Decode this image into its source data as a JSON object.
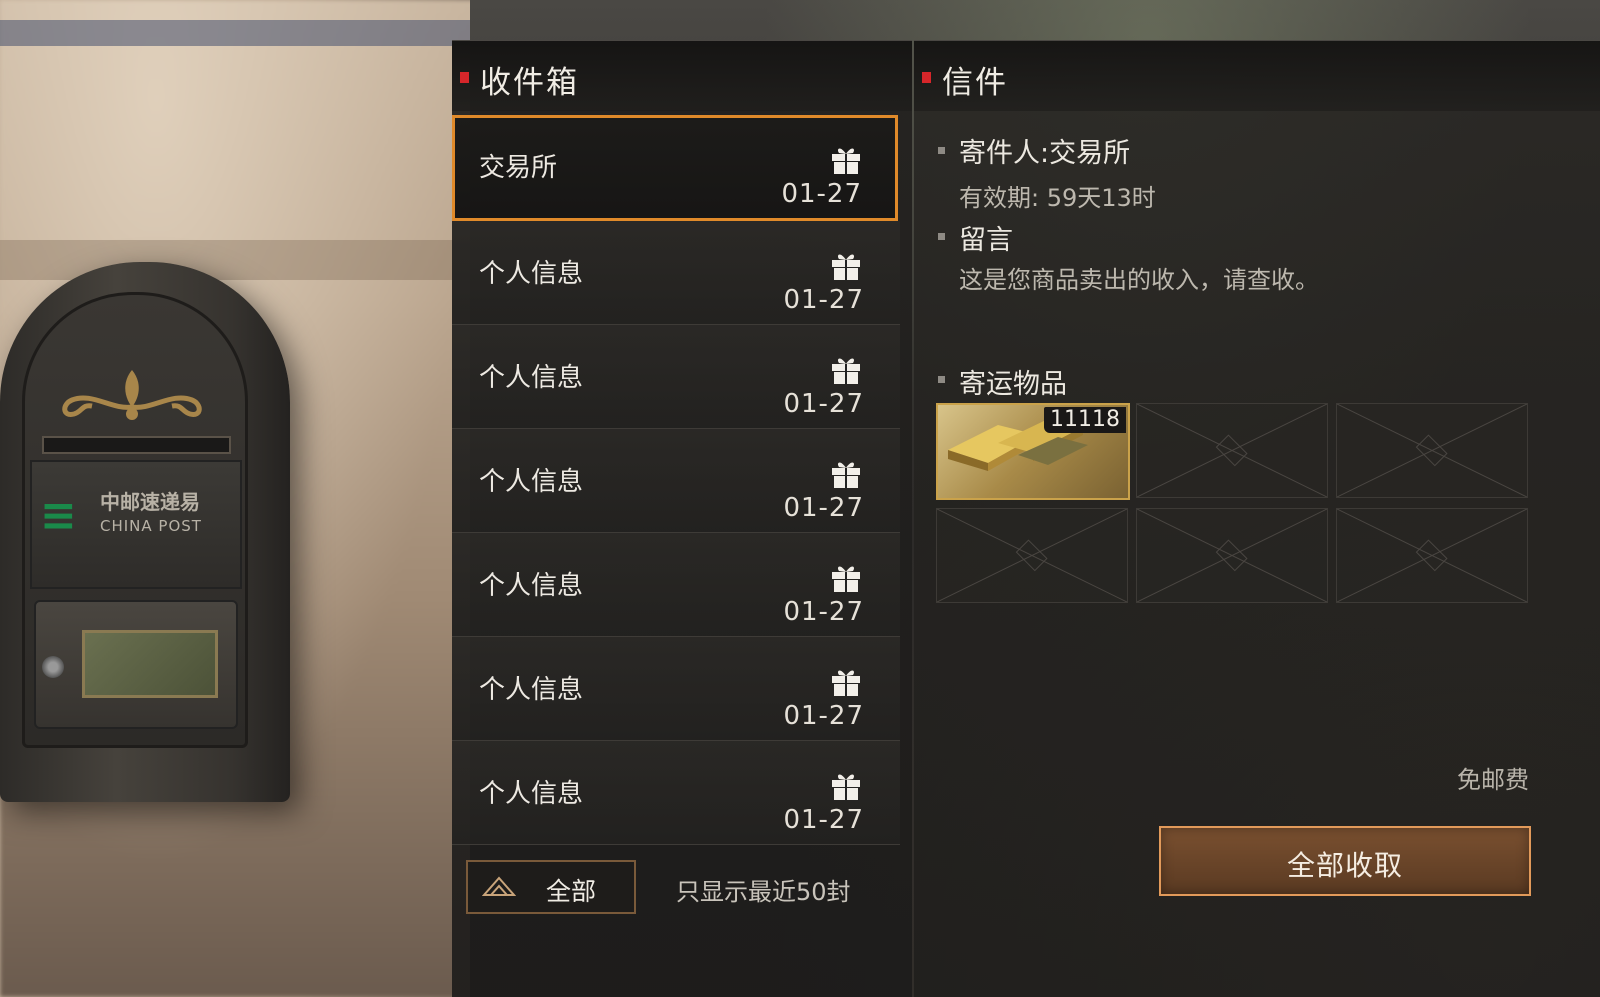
{
  "inbox": {
    "title": "收件箱",
    "items": [
      {
        "sender": "交易所",
        "date": "01-27",
        "icon": "gift-icon",
        "selected": true
      },
      {
        "sender": "个人信息",
        "date": "01-27",
        "icon": "gift-icon"
      },
      {
        "sender": "个人信息",
        "date": "01-27",
        "icon": "gift-icon"
      },
      {
        "sender": "个人信息",
        "date": "01-27",
        "icon": "gift-icon"
      },
      {
        "sender": "个人信息",
        "date": "01-27",
        "icon": "gift-icon"
      },
      {
        "sender": "个人信息",
        "date": "01-27",
        "icon": "gift-icon"
      },
      {
        "sender": "个人信息",
        "date": "01-27",
        "icon": "gift-icon"
      }
    ],
    "filter_label": "全部",
    "recent_note": "只显示最近50封"
  },
  "letter": {
    "title": "信件",
    "sender_line": "寄件人:交易所",
    "validity": "有效期: 59天13时",
    "message_heading": "留言",
    "message": "这是您商品卖出的收入，请查收。",
    "attachments_heading": "寄运物品",
    "attachments": [
      {
        "item": "gold-bar-icon",
        "quantity": "11118"
      }
    ],
    "postage": "免邮费",
    "collect_all_label": "全部收取"
  },
  "mailbox": {
    "logo_cn": "中邮速递易",
    "logo_en": "CHINA POST"
  },
  "colors": {
    "accent_orange": "#e08a2a",
    "header_mark_red": "#d6262a",
    "button_brown": "#6a4428"
  }
}
